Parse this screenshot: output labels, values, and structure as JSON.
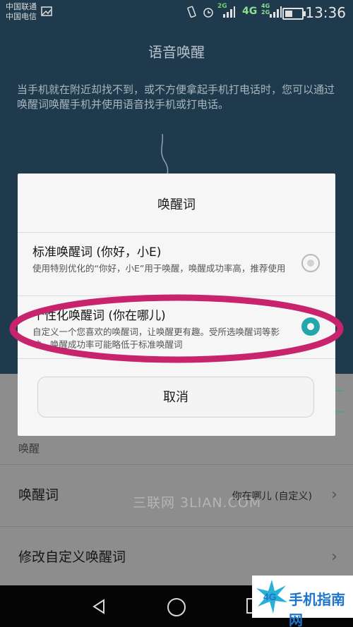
{
  "status_bar": {
    "carrier1": "中国联通",
    "carrier2": "中国电信",
    "net1": "2G",
    "net2": "4G",
    "net3": "4G\n2G",
    "time": "13:36"
  },
  "background": {
    "title": "语音唤醒",
    "description": "当手机就在附近却找不到，或不方便拿起手机打电话时，您可以通过唤醒词唤醒手机并使用语音找手机或打电话。",
    "section_label": "唤醒",
    "rows": [
      {
        "label": "唤醒词",
        "value": "你在哪儿 (自定义)"
      },
      {
        "label": "修改自定义唤醒词",
        "value": ""
      }
    ],
    "watermark": "三联网 3LIAN.COM"
  },
  "dialog": {
    "title": "唤醒词",
    "options": [
      {
        "title": "标准唤醒词 (你好，小E)",
        "desc": "使用特别优化的“你好，小E”用于唤醒，唤醒成功率高，推荐使用",
        "selected": false
      },
      {
        "title": "个性化唤醒词 (你在哪儿)",
        "desc": "自定义一个您喜欢的唤醒词，让唤醒更有趣。受所选唤醒词等影响，唤醒成功率可能略低于标准唤醒词",
        "selected": true
      }
    ],
    "cancel": "取消"
  },
  "logo": {
    "badge": "4G",
    "text": "手机指南网"
  },
  "colors": {
    "accent": "#23a7ab",
    "highlight": "#c8246e"
  }
}
